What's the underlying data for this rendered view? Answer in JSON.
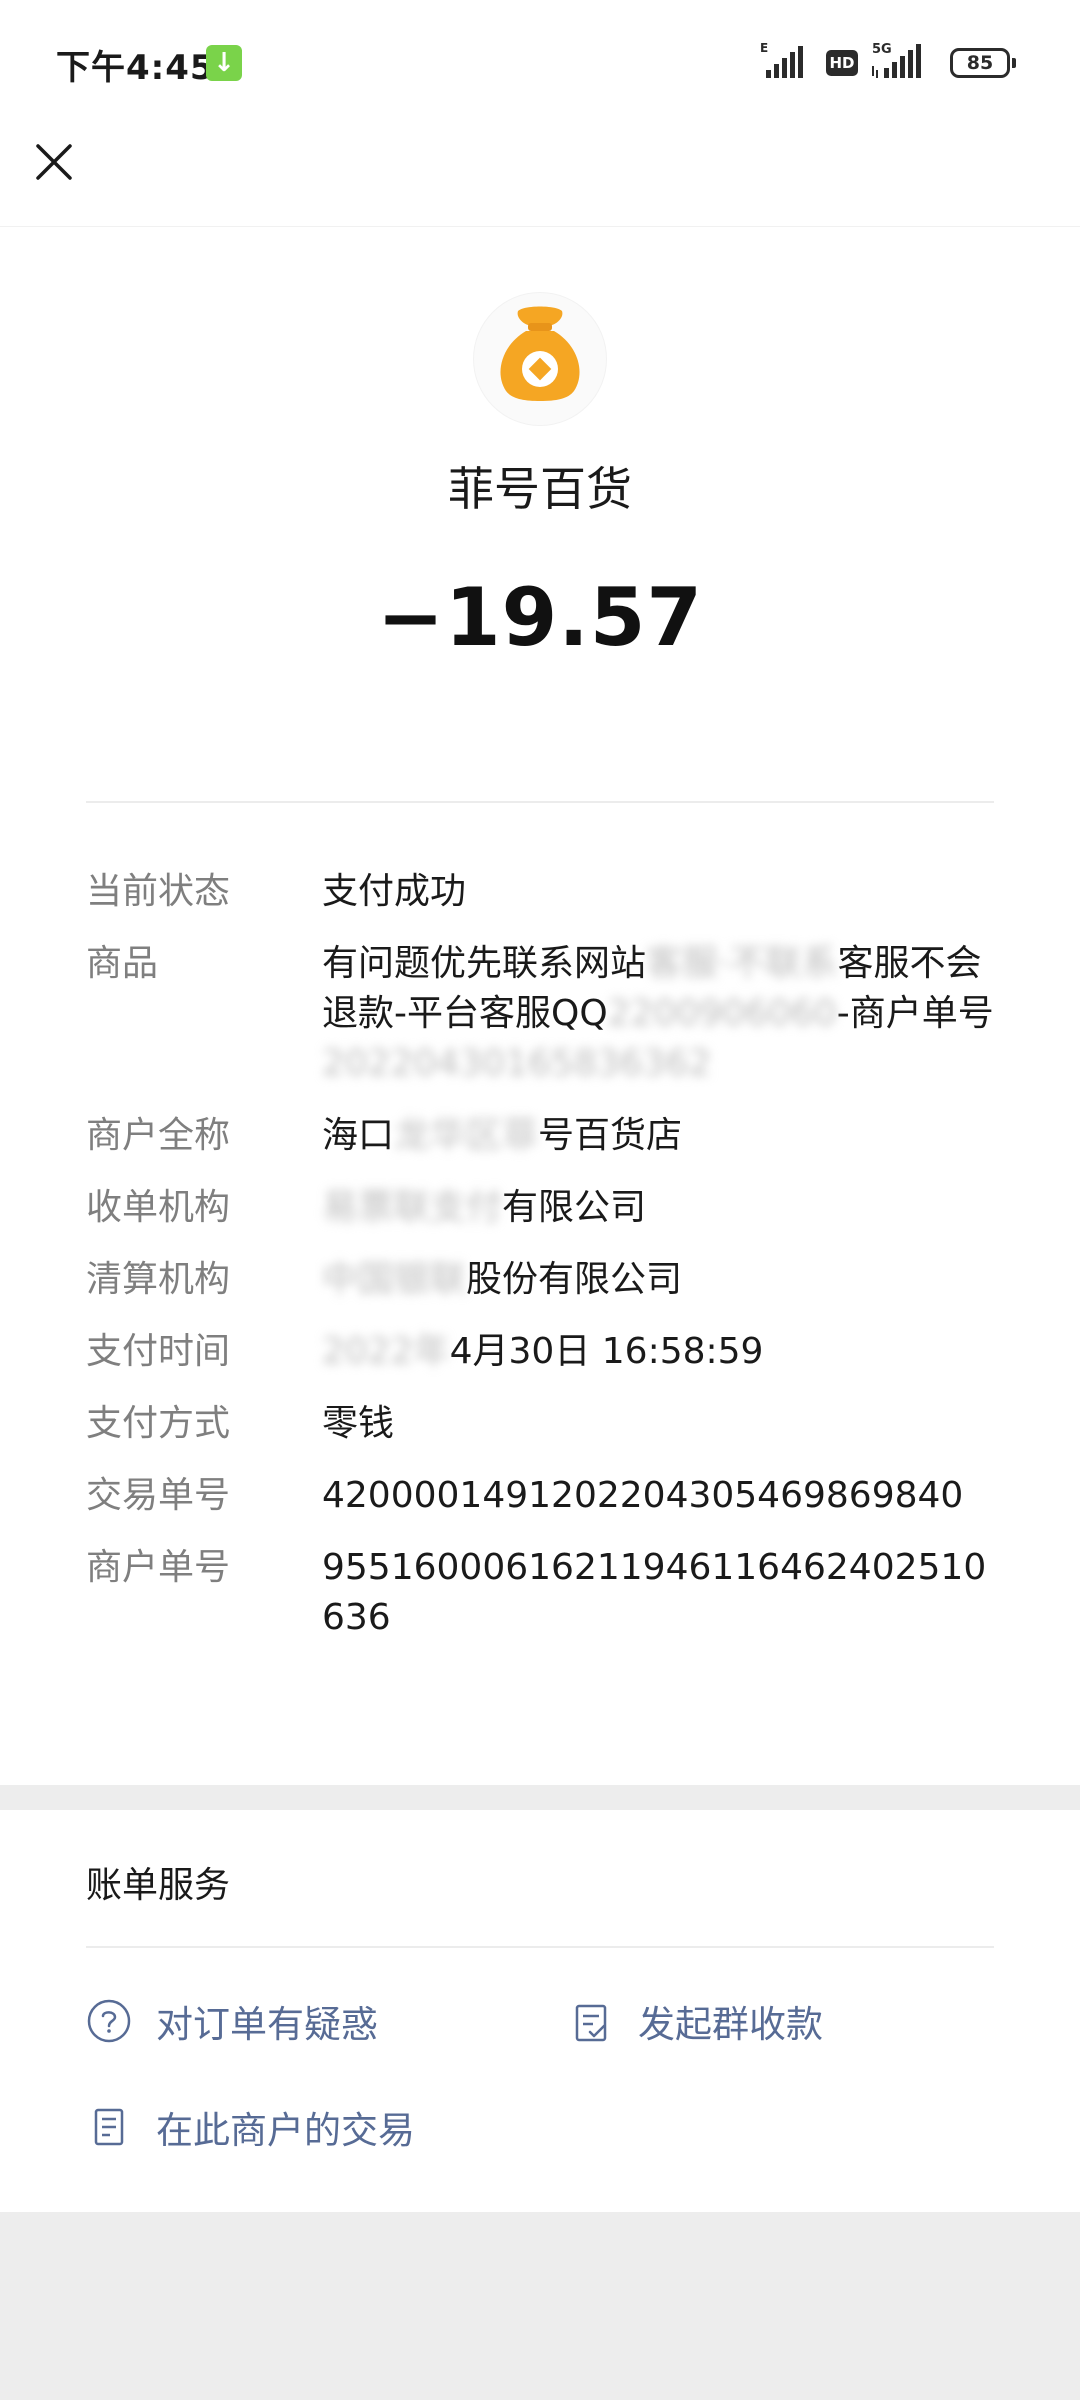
{
  "status_bar": {
    "time": "下午4:45",
    "download_badge": "↓",
    "network_e": "E",
    "hd": "HD",
    "network_5g": "5G",
    "battery": "85"
  },
  "payment": {
    "merchant_name": "菲号百货",
    "amount": "−19.57"
  },
  "details": [
    {
      "label": "当前状态",
      "value": "支付成功"
    },
    {
      "label": "商品",
      "value_parts": [
        "有问题优先联系网站",
        "客服·不联系",
        "客服不会退款-平台客服QQ",
        "2200906060",
        "-商户单号",
        "20220430165836362"
      ]
    },
    {
      "label": "商户全称",
      "value_parts": [
        "海口",
        "龙华区菲",
        "号百货店"
      ]
    },
    {
      "label": "收单机构",
      "value_parts": [
        "易票联支付",
        "有限公司"
      ]
    },
    {
      "label": "清算机构",
      "value_parts": [
        "中国银联",
        "股份有限公司"
      ]
    },
    {
      "label": "支付时间",
      "value_parts": [
        "2022年",
        "4月30日 16:58:59"
      ]
    },
    {
      "label": "支付方式",
      "value": "零钱"
    },
    {
      "label": "交易单号",
      "value": "4200001491202204305469869840"
    },
    {
      "label": "商户单号",
      "value": "95516000616211946116462402510636"
    }
  ],
  "services": {
    "title": "账单服务",
    "items": [
      {
        "label": "对订单有疑惑",
        "icon": "question-circle-icon"
      },
      {
        "label": "发起群收款",
        "icon": "clipboard-check-icon"
      },
      {
        "label": "在此商户的交易",
        "icon": "document-list-icon"
      }
    ]
  },
  "colors": {
    "link": "#576b95",
    "label": "#7f7f7f",
    "icon_orange": "#f5a623",
    "background": "#ededed"
  }
}
